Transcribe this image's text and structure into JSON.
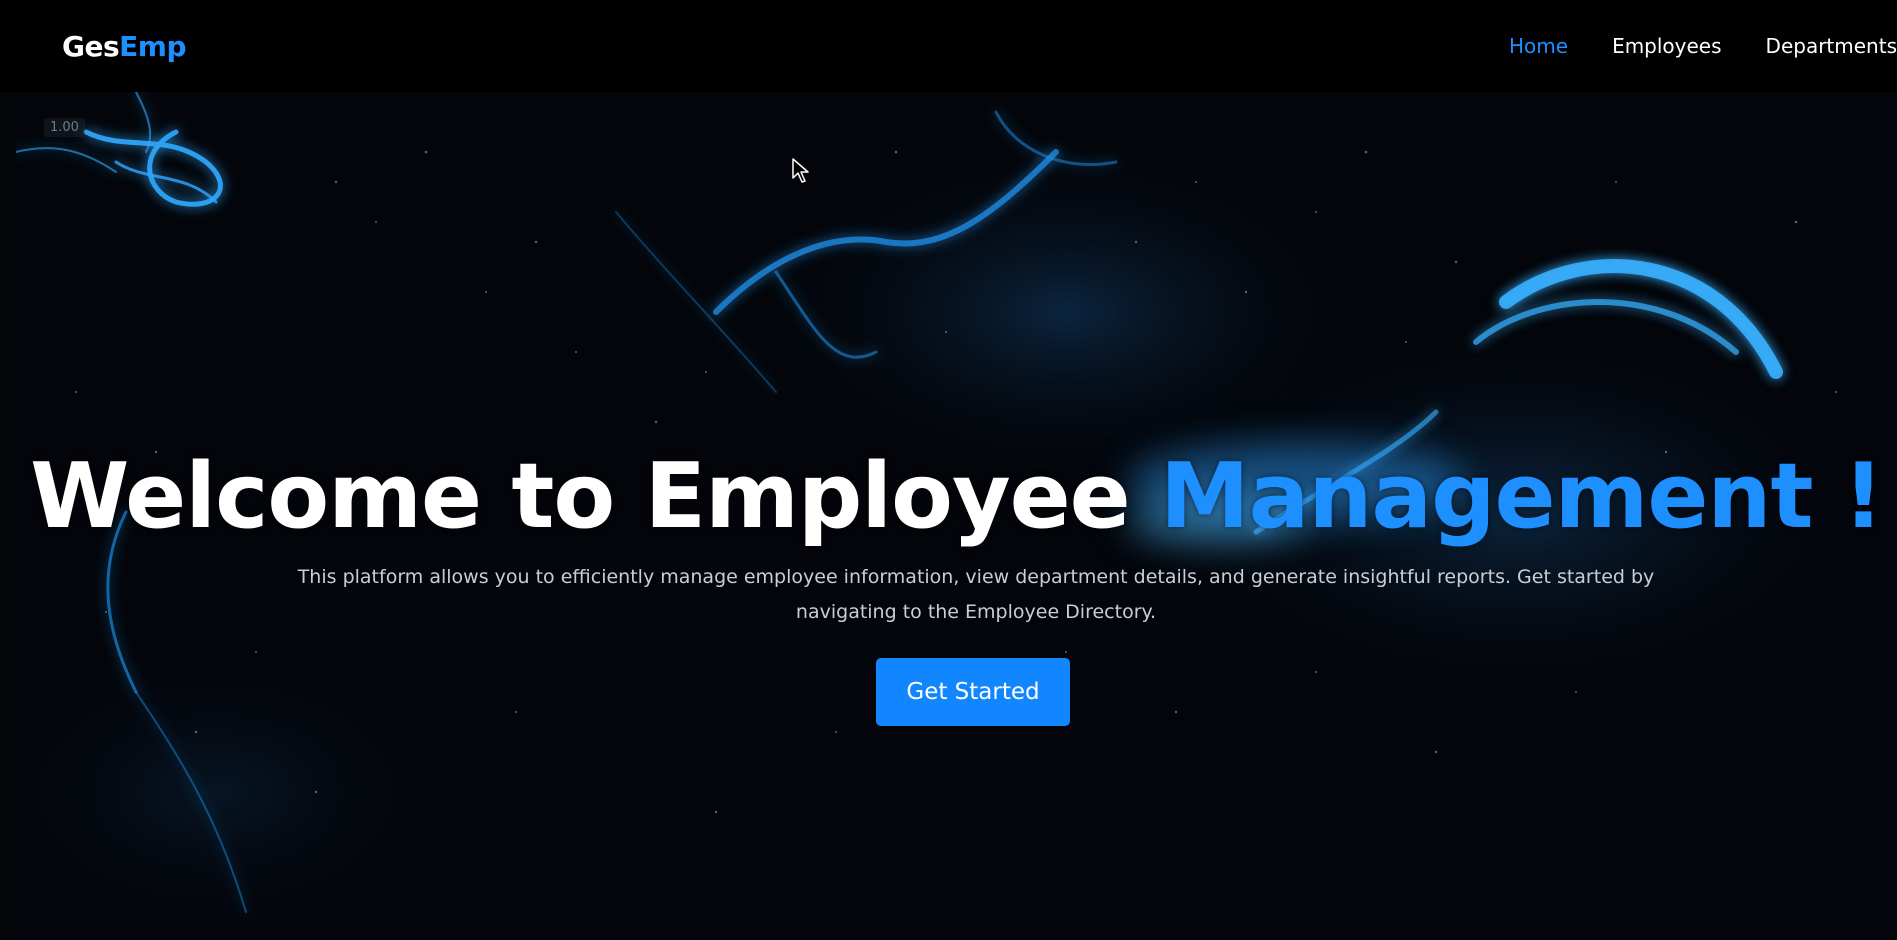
{
  "brand": {
    "prefix": "Ges",
    "accent": "Emp"
  },
  "nav": {
    "items": [
      {
        "label": "Home",
        "active": true
      },
      {
        "label": "Employees",
        "active": false
      },
      {
        "label": "Departments",
        "active": false
      }
    ]
  },
  "hero": {
    "zoom": "1.00",
    "title_main": "Welcome to Employee ",
    "title_accent": "Management !",
    "description": "This platform allows you to efficiently manage employee information, view department details, and generate insightful reports. Get started by navigating to the Employee Directory.",
    "cta_label": "Get Started"
  },
  "colors": {
    "accent": "#1e8fff",
    "button": "#1286ff",
    "nav_bg": "#000000",
    "background": "#03050a"
  },
  "icons": {
    "pointer": "mouse-cursor-icon"
  }
}
